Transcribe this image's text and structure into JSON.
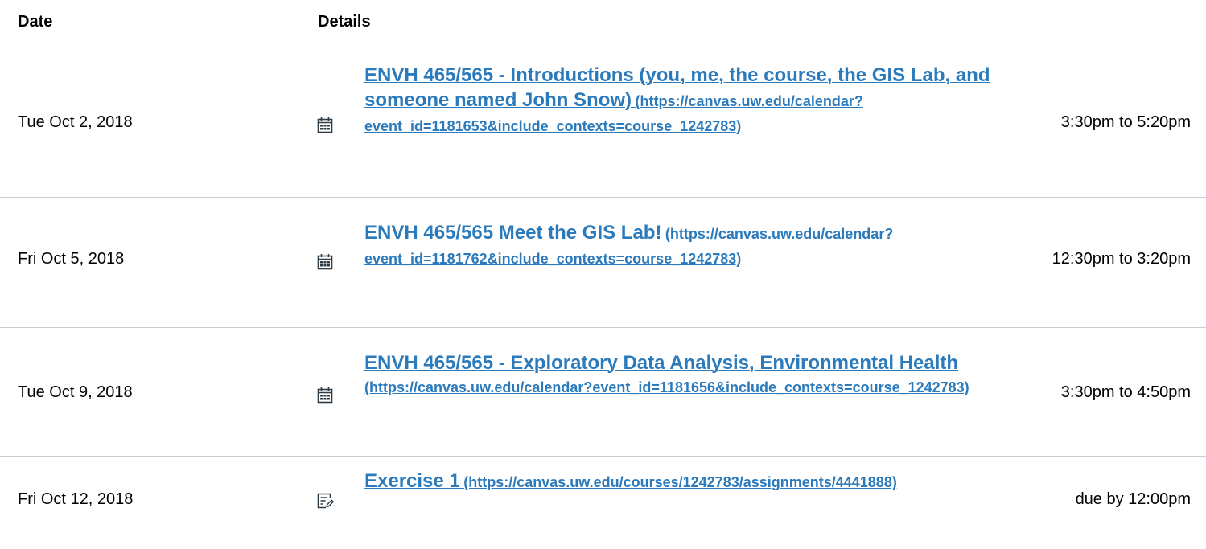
{
  "header": {
    "date_label": "Date",
    "details_label": "Details"
  },
  "rows": [
    {
      "date": "Tue Oct 2, 2018",
      "icon": "calendar-icon",
      "title": "ENVH 465/565 - Introductions (you, me, the course, the GIS Lab, and someone named John Snow)",
      "url": "(https://canvas.uw.edu/calendar?event_id=1181653&include_contexts=course_1242783)",
      "time": "3:30pm to 5:20pm"
    },
    {
      "date": "Fri Oct 5, 2018",
      "icon": "calendar-icon",
      "title": "ENVH 465/565 Meet the GIS Lab!",
      "url": "(https://canvas.uw.edu/calendar?event_id=1181762&include_contexts=course_1242783)",
      "time": "12:30pm to 3:20pm"
    },
    {
      "date": "Tue Oct 9, 2018",
      "icon": "calendar-icon",
      "title": "ENVH 465/565 - Exploratory Data Analysis, Environmental Health",
      "url": "(https://canvas.uw.edu/calendar?event_id=1181656&include_contexts=course_1242783)",
      "time": "3:30pm to 4:50pm"
    },
    {
      "date": "Fri Oct 12, 2018",
      "icon": "assignment-icon",
      "title": "Exercise 1",
      "url": "(https://canvas.uw.edu/courses/1242783/assignments/4441888)",
      "time": "due by 12:00pm"
    }
  ],
  "colors": {
    "link": "#2b7abc",
    "divider": "#c7cdd1",
    "text": "#000000"
  }
}
